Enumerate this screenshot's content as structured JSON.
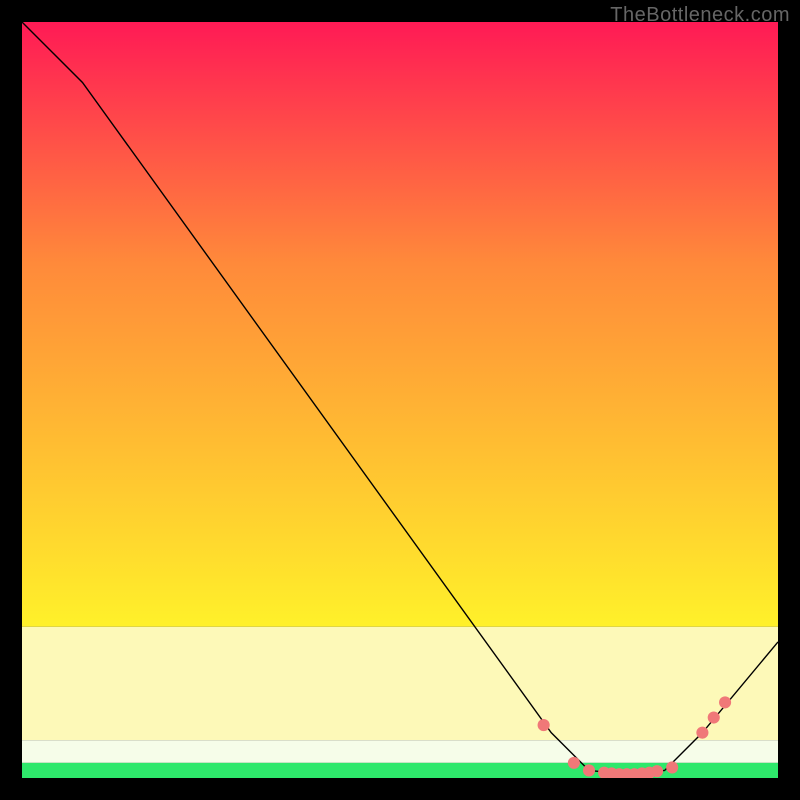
{
  "watermark": "TheBottleneck.com",
  "colors": {
    "frame": "#000000",
    "line": "#000000",
    "marker": "#f07878",
    "green": "#2ee86b",
    "greenish_white": "#f6fde9",
    "pale_yellow": "#fdf9b8",
    "gradient_top": "#ff1a55",
    "gradient_mid_orange": "#ff8a3a",
    "gradient_yellow": "#fff12a"
  },
  "chart_data": {
    "type": "line",
    "title": "",
    "xlabel": "",
    "ylabel": "",
    "xlim": [
      0,
      100
    ],
    "ylim": [
      0,
      100
    ],
    "series": [
      {
        "name": "curve",
        "x": [
          0,
          8,
          70,
          75,
          80,
          85,
          90,
          100
        ],
        "y": [
          100,
          92,
          6,
          1,
          0.5,
          1,
          6,
          18
        ]
      }
    ],
    "markers": {
      "name": "highlight-points",
      "x": [
        69,
        73,
        75,
        77,
        78,
        79,
        80,
        81,
        82,
        83,
        84,
        86,
        90,
        91.5,
        93
      ],
      "y": [
        7,
        2,
        1,
        0.7,
        0.6,
        0.5,
        0.5,
        0.5,
        0.6,
        0.7,
        0.9,
        1.4,
        6,
        8,
        10
      ]
    },
    "background_bands": [
      {
        "name": "green",
        "y0": 0,
        "y1": 2
      },
      {
        "name": "greenish-white",
        "y0": 2,
        "y1": 5
      },
      {
        "name": "pale-yellow",
        "y0": 5,
        "y1": 20
      },
      {
        "name": "gradient",
        "y0": 20,
        "y1": 100
      }
    ]
  }
}
